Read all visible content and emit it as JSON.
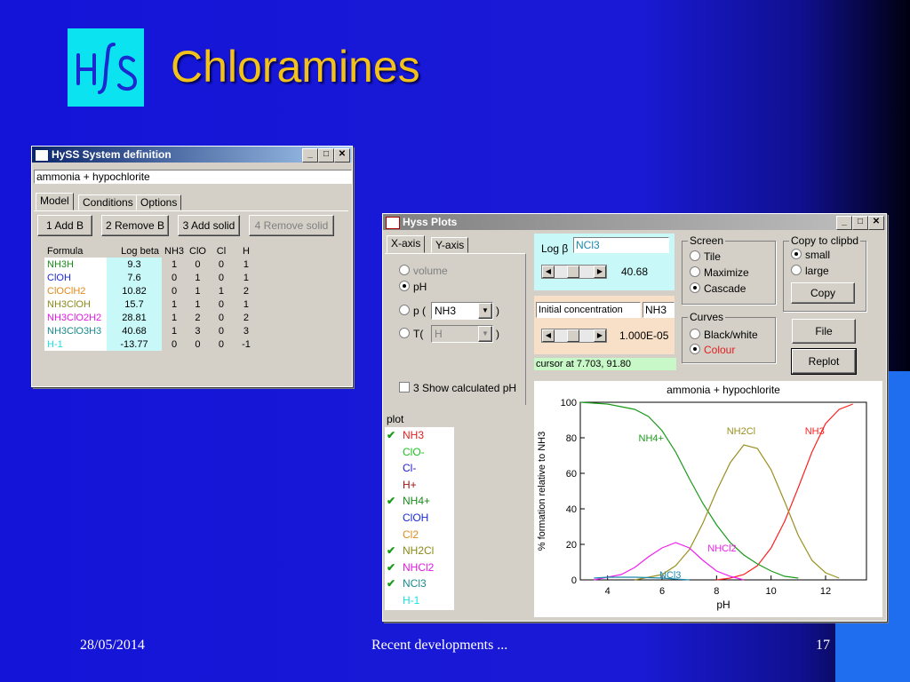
{
  "slide": {
    "title": "Chloramines",
    "logo_text": "HySS",
    "footer_date": "28/05/2014",
    "footer_center": "Recent developments ...",
    "footer_page": "17"
  },
  "sysdef": {
    "title": "HySS System definition",
    "name_value": "ammonia + hypochlorite",
    "tabs": [
      "Model",
      "Conditions",
      "Options"
    ],
    "buttons": [
      "1 Add B",
      "2 Remove B",
      "3 Add solid",
      "4 Remove solid"
    ],
    "headers": [
      "Formula",
      "Log beta",
      "NH3",
      "ClO",
      "Cl",
      "H"
    ],
    "rows": [
      {
        "formula": "NH3H",
        "color": "#1a8a1a",
        "logbeta": "9.3",
        "c": [
          "1",
          "0",
          "0",
          "1"
        ]
      },
      {
        "formula": "ClOH",
        "color": "#1a2ad0",
        "logbeta": "7.6",
        "c": [
          "0",
          "1",
          "0",
          "1"
        ]
      },
      {
        "formula": "ClOClH2",
        "color": "#e08a1a",
        "logbeta": "10.82",
        "c": [
          "0",
          "1",
          "1",
          "2"
        ]
      },
      {
        "formula": "NH3ClOH",
        "color": "#8a8a1a",
        "logbeta": "15.7",
        "c": [
          "1",
          "1",
          "0",
          "1"
        ]
      },
      {
        "formula": "NH3ClO2H2",
        "color": "#e01ae0",
        "logbeta": "28.81",
        "c": [
          "1",
          "2",
          "0",
          "2"
        ]
      },
      {
        "formula": "NH3ClO3H3",
        "color": "#1a8a8a",
        "logbeta": "40.68",
        "c": [
          "1",
          "3",
          "0",
          "3"
        ]
      },
      {
        "formula": "H-1",
        "color": "#1ae0e0",
        "logbeta": "-13.77",
        "c": [
          "0",
          "0",
          "0",
          "-1"
        ]
      }
    ]
  },
  "plots": {
    "title": "Hyss Plots",
    "tabs": [
      "X-axis",
      "Y-axis"
    ],
    "xaxis_options": {
      "volume": "volume",
      "pH": "pH",
      "p": "p (",
      "p_select": "NH3",
      "T": "T(",
      "T_select": "H",
      "close": ")"
    },
    "show_calc_ph": "3 Show calculated pH",
    "logbeta_label": "Log β",
    "logbeta_species": "NCl3",
    "logbeta_value": "40.68",
    "init_conc_label": "Initial concentration",
    "init_conc_species": "NH3",
    "init_conc_value": "1.000E-05",
    "cursor_text": "cursor at 7.703, 91.80",
    "screen_group": "Screen",
    "screen_options": [
      "Tile",
      "Maximize",
      "Cascade"
    ],
    "screen_selected": "Cascade",
    "copy_group": "Copy to clipbd",
    "copy_options": [
      "small",
      "large"
    ],
    "copy_selected": "small",
    "copy_button": "Copy",
    "curves_group": "Curves",
    "curves_options": [
      "Black/white",
      "Colour"
    ],
    "curves_selected": "Colour",
    "file_button": "File",
    "replot_button": "Replot",
    "plot_label": "plot",
    "species": [
      {
        "name": "NH3",
        "color": "#e02020",
        "checked": true
      },
      {
        "name": "ClO-",
        "color": "#20c020",
        "checked": false
      },
      {
        "name": "Cl-",
        "color": "#2020d0",
        "checked": false
      },
      {
        "name": "H+",
        "color": "#a01010",
        "checked": false
      },
      {
        "name": "NH4+",
        "color": "#1a8a1a",
        "checked": true
      },
      {
        "name": "ClOH",
        "color": "#1a2ad0",
        "checked": false
      },
      {
        "name": "Cl2",
        "color": "#e08a1a",
        "checked": false
      },
      {
        "name": "NH2Cl",
        "color": "#8a8a1a",
        "checked": true
      },
      {
        "name": "NHCl2",
        "color": "#e01ae0",
        "checked": true
      },
      {
        "name": "NCl3",
        "color": "#1a8a8a",
        "checked": true
      },
      {
        "name": "H-1",
        "color": "#1ae0e0",
        "checked": false
      }
    ]
  },
  "chart_data": {
    "type": "line",
    "title": "ammonia + hypochlorite",
    "xlabel": "pH",
    "ylabel": "% formation relative to NH3",
    "xlim": [
      3,
      13.5
    ],
    "ylim": [
      0,
      100
    ],
    "xticks": [
      4,
      6,
      8,
      10,
      12
    ],
    "yticks": [
      0,
      20,
      40,
      60,
      80,
      100
    ],
    "series": [
      {
        "name": "NH3",
        "color": "#ff2020",
        "x": [
          8.0,
          8.5,
          9,
          9.5,
          10,
          10.5,
          11,
          11.5,
          12,
          12.5,
          13
        ],
        "y": [
          0,
          1,
          3,
          8,
          18,
          33,
          52,
          72,
          88,
          96,
          99
        ]
      },
      {
        "name": "NH4+",
        "color": "#1a9a1a",
        "x": [
          3,
          4,
          5,
          5.5,
          6,
          6.5,
          7,
          7.5,
          8,
          8.5,
          9,
          9.5,
          10,
          10.5,
          11
        ],
        "y": [
          100,
          99,
          96,
          92,
          84,
          72,
          57,
          43,
          31,
          21,
          14,
          9,
          5,
          2,
          1
        ]
      },
      {
        "name": "NH2Cl",
        "color": "#999020",
        "x": [
          5,
          6,
          6.5,
          7,
          7.5,
          8,
          8.5,
          9,
          9.5,
          10,
          10.5,
          11,
          11.5,
          12,
          12.5
        ],
        "y": [
          0,
          3,
          8,
          17,
          32,
          50,
          66,
          76,
          74,
          62,
          44,
          25,
          11,
          4,
          1
        ]
      },
      {
        "name": "NHCl2",
        "color": "#f020f0",
        "x": [
          3.5,
          4.5,
          5,
          5.5,
          6,
          6.5,
          7,
          7.5,
          8,
          8.5,
          9
        ],
        "y": [
          0,
          3,
          7,
          13,
          18,
          21,
          18,
          11,
          5,
          2,
          0
        ]
      },
      {
        "name": "NCl3",
        "color": "#1a8aaa",
        "x": [
          3.5,
          4,
          5,
          6,
          6.5,
          7
        ],
        "y": [
          1,
          1.5,
          1.5,
          1,
          0.5,
          0
        ]
      }
    ],
    "series_labels": [
      "NH4+",
      "NH2Cl",
      "NH3",
      "NHCl2",
      "NCl3"
    ]
  }
}
